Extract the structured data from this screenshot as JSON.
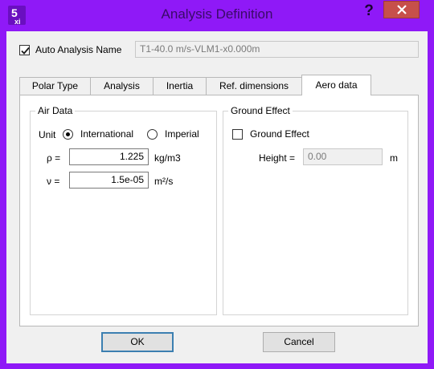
{
  "window": {
    "title": "Analysis Definition",
    "help_label": "?"
  },
  "auto_name": {
    "label": "Auto Analysis Name",
    "checked": true,
    "value": "T1-40.0 m/s-VLM1-x0.000m"
  },
  "tabs": [
    {
      "label": "Polar Type"
    },
    {
      "label": "Analysis"
    },
    {
      "label": "Inertia"
    },
    {
      "label": "Ref. dimensions"
    },
    {
      "label": "Aero data"
    }
  ],
  "air_data": {
    "title": "Air Data",
    "unit_label": "Unit",
    "international_label": "International",
    "imperial_label": "Imperial",
    "rho_symbol": "ρ =",
    "rho_value": "1.225",
    "rho_unit": "kg/m3",
    "nu_symbol": "ν =",
    "nu_value": "1.5e-05",
    "nu_unit": "m²/s"
  },
  "ground_effect": {
    "title": "Ground Effect",
    "checkbox_label": "Ground Effect",
    "height_label": "Height =",
    "height_value": "0.00",
    "height_unit": "m"
  },
  "buttons": {
    "ok": "OK",
    "cancel": "Cancel"
  }
}
